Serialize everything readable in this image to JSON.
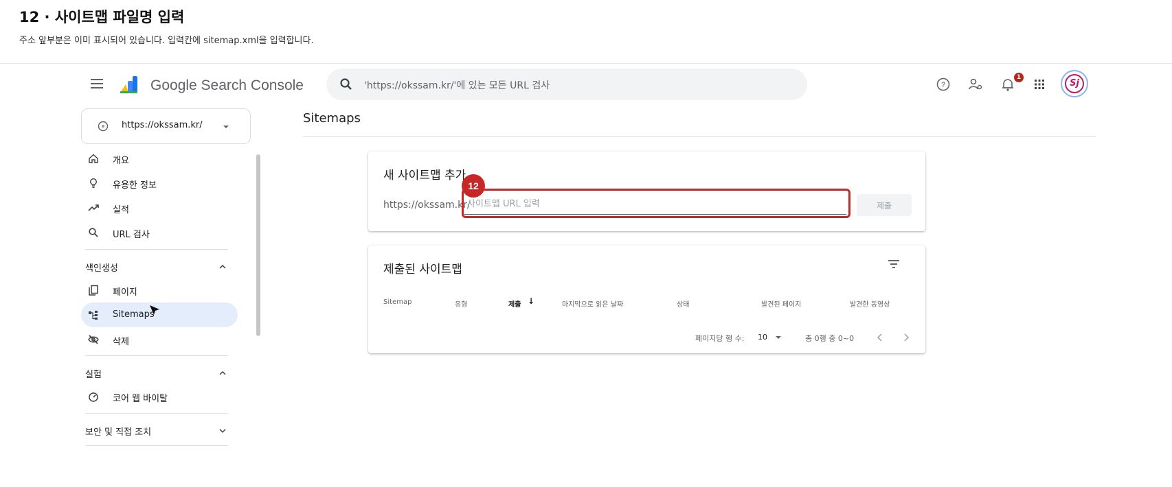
{
  "tutorial": {
    "title": "12 · 사이트맵 파일명 입력",
    "subtitle": "주소 앞부분은 이미 표시되어 있습니다. 입력칸에 sitemap.xml을 입력합니다."
  },
  "header": {
    "product_name": "Google Search Console",
    "search_placeholder": "'https://okssam.kr/'에 있는 모든 URL 검사",
    "notification_count": "1",
    "avatar_text": "Sj"
  },
  "property": {
    "url": "https://okssam.kr/"
  },
  "sidebar": {
    "items": [
      {
        "label": "개요",
        "icon": "home-icon"
      },
      {
        "label": "유용한 정보",
        "icon": "lightbulb-icon"
      },
      {
        "label": "실적",
        "icon": "trending-icon"
      },
      {
        "label": "URL 검사",
        "icon": "search-icon"
      }
    ],
    "sections": [
      {
        "label": "색인생성",
        "expanded": true,
        "items": [
          {
            "label": "페이지",
            "icon": "pages-icon"
          },
          {
            "label": "Sitemaps",
            "icon": "sitemap-icon",
            "active": true
          },
          {
            "label": "삭제",
            "icon": "eye-off-icon"
          }
        ]
      },
      {
        "label": "실험",
        "expanded": true,
        "items": [
          {
            "label": "코어 웹 바이탈",
            "icon": "gauge-icon"
          }
        ]
      },
      {
        "label": "보안 및 직접 조치",
        "expanded": false,
        "items": []
      }
    ]
  },
  "main": {
    "page_title": "Sitemaps",
    "add_card": {
      "title": "새 사이트맵 추가",
      "url_prefix": "https://okssam.kr/",
      "input_placeholder": "사이트맵 URL 입력",
      "submit_label": "제출",
      "step_number": "12"
    },
    "submitted_card": {
      "title": "제출된 사이트맵",
      "columns": [
        "Sitemap",
        "유형",
        "제출",
        "마지막으로 읽은 날짜",
        "상태",
        "발견된 페이지",
        "발견한 동영상"
      ],
      "sort_arrow": "↓",
      "rows_per_page_label": "페이지당 행 수:",
      "rows_per_page_value": "10",
      "range_text": "총 0행 중 0~0"
    }
  },
  "colors": {
    "highlight": "#c62828",
    "active_nav": "#e3edfc",
    "accent_blue": "#1a73e8"
  }
}
